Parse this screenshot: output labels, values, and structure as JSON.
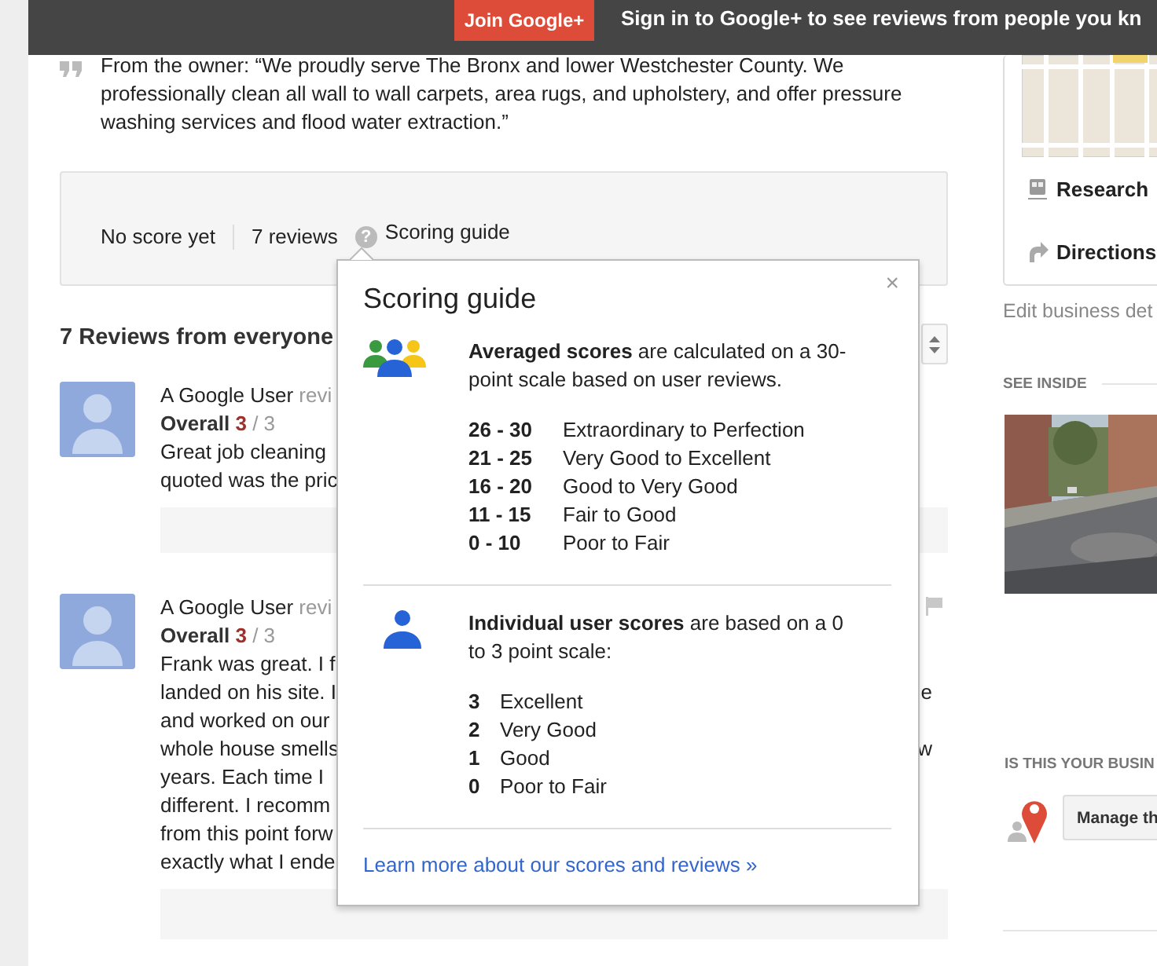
{
  "top_bar": {
    "join_button": "Join Google+",
    "message": "Sign in to Google+ to see reviews from people you kn"
  },
  "owner_quote": "From the owner: “We proudly serve The Bronx and lower Westchester County. We professionally clean all wall to wall carpets, area rugs, and upholstery, and offer pressure washing services and flood water extraction.”",
  "score_summary": {
    "score": "No score yet",
    "reviews": "7 reviews",
    "help_icon": "?",
    "guide_link": "Scoring guide"
  },
  "reviews_heading": "7 Reviews from everyone",
  "reviews": [
    {
      "author": "A Google User",
      "meta": "revi",
      "overall_label": "Overall",
      "score": "3",
      "score_max": "/ 3",
      "lines": [
        {
          "text": "Great job cleaning"
        },
        {
          "text": "quoted was the pric"
        }
      ]
    },
    {
      "author": "A Google User",
      "meta": "revi",
      "overall_label": "Overall",
      "score": "3",
      "score_max": "/ 3",
      "flag_icon": true,
      "lines": [
        {
          "text": "Frank was great. I f"
        },
        {
          "text": "landed on his site. I",
          "end": "e"
        },
        {
          "text": "and worked on our"
        },
        {
          "text": "whole house smells",
          "end": "w"
        },
        {
          "text": "years. Each time I"
        },
        {
          "text": "different. I recomm"
        },
        {
          "text": "from this point forw"
        },
        {
          "text": "exactly what I ende"
        }
      ]
    }
  ],
  "scoring_popover": {
    "title": "Scoring guide",
    "close": "×",
    "sections": [
      {
        "kind": "averaged",
        "text": "**Averaged scores** are calculated on a 30-point scale based on user reviews.",
        "rows": [
          {
            "score": "26 - 30",
            "label": "Extraordinary to Perfection"
          },
          {
            "score": "21 - 25",
            "label": "Very Good to Excellent"
          },
          {
            "score": "16 - 20",
            "label": "Good to Very Good"
          },
          {
            "score": "11 - 15",
            "label": "Fair to Good"
          },
          {
            "score": "0 - 10",
            "label": "Poor to Fair"
          }
        ]
      },
      {
        "kind": "individual",
        "text": "**Individual user scores** are based on a 0 to 3 point scale:",
        "rows": [
          {
            "score": "3",
            "label": "Excellent"
          },
          {
            "score": "2",
            "label": "Very Good"
          },
          {
            "score": "1",
            "label": "Good"
          },
          {
            "score": "0",
            "label": "Poor to Fair"
          }
        ]
      }
    ],
    "link": "Learn more about our scores and reviews »"
  },
  "sidebar": {
    "actions": [
      {
        "kind": "research",
        "label": "Research"
      },
      {
        "kind": "directions",
        "label": "Directions"
      }
    ],
    "edit_link": "Edit business det",
    "see_inside_heading": "SEE INSIDE",
    "claim_heading": "IS THIS YOUR BUSIN",
    "manage_button": "Manage th"
  }
}
